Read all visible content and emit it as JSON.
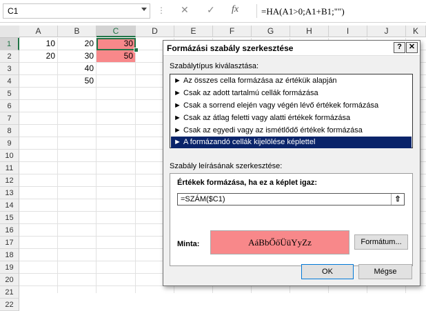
{
  "formula_bar": {
    "name_box": "C1",
    "dots": "⋮",
    "cancel_glyph": "✕",
    "enter_glyph": "✓",
    "fx_glyph": "fx",
    "formula": "=HA(A1>0;A1+B1;\"\")"
  },
  "columns": [
    "A",
    "B",
    "C",
    "D",
    "E",
    "F",
    "G",
    "H",
    "I",
    "J",
    "K"
  ],
  "rows": [
    "1",
    "2",
    "3",
    "4",
    "5",
    "6",
    "7",
    "8",
    "9",
    "10",
    "11",
    "12",
    "13",
    "14",
    "15",
    "16",
    "17",
    "18",
    "19",
    "20",
    "21",
    "22"
  ],
  "cells": {
    "a1": "10",
    "b1": "20",
    "c1": "30",
    "a2": "20",
    "b2": "30",
    "c2": "50",
    "b3": "40",
    "b4": "50"
  },
  "highlight_color": "#f8888a",
  "dialog": {
    "title": "Formázási szabály szerkesztése",
    "help_label": "?",
    "close_label": "✕",
    "type_label": "Szabálytípus kiválasztása:",
    "rule_types": [
      "Az összes cella formázása az értékük alapján",
      "Csak az adott tartalmú cellák formázása",
      "Csak a sorrend elején vagy végén lévő értékek formázása",
      "Csak az átlag feletti vagy alatti értékek formázása",
      "Csak az egyedi vagy az ismétlődő értékek formázása",
      "A formázandó cellák kijelölése képlettel"
    ],
    "rule_arrow": "►",
    "edit_label": "Szabály leírásának szerkesztése:",
    "formula_title": "Értékek formázása, ha ez a képlet igaz:",
    "formula_value": "=SZÁM($C1)",
    "collapse_glyph": "⇧",
    "preview_label": "Minta:",
    "preview_text": "AáBbŐőÜüYyZz",
    "format_button": "Formátum...",
    "ok_button": "OK",
    "cancel_button": "Mégse"
  }
}
